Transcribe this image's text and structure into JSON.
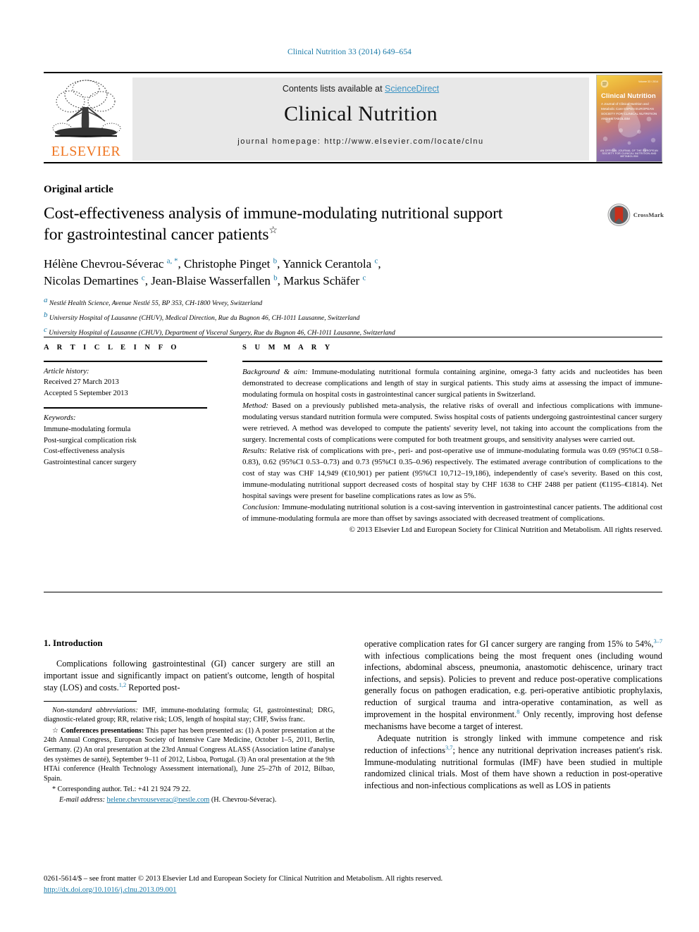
{
  "running_head": "Clinical Nutrition 33 (2014) 649–654",
  "masthead": {
    "contents_prefix": "Contents lists available at ",
    "sciencedirect": "ScienceDirect",
    "journal_name": "Clinical Nutrition",
    "homepage": "journal homepage: http://www.elsevier.com/locate/clnu",
    "publisher": "ELSEVIER",
    "cover": {
      "title": "Clinical Nutrition",
      "subtitle": "A Journal of Clinical Nutrition and Metabolic Care\nESPEN EUROPEAN SOCIETY FOR CLINICAL NUTRITION AND METABOLISM",
      "issue_line": "Volume 33 / 2014",
      "footer": "AN OFFICIAL JOURNAL OF THE EUROPEAN SOCIETY FOR CLINICAL NUTRITION AND METABOLISM"
    }
  },
  "article": {
    "type_label": "Original article",
    "title_line1": "Cost-effectiveness analysis of immune-modulating nutritional support",
    "title_line2": "for gastrointestinal cancer patients",
    "title_marker": "☆",
    "crossmark_label": "CrossMark",
    "authors_line1_html": "Hélène Chevrou-Séverac <sup>a, *</sup>, Christophe Pinget <sup>b</sup>, Yannick Cerantola <sup>c</sup>,",
    "authors_line2_html": "Nicolas Demartines <sup>c</sup>, Jean-Blaise Wasserfallen <sup>b</sup>, Markus Schäfer <sup>c</sup>",
    "affiliations": [
      {
        "mark": "a",
        "text": "Nestlé Health Science, Avenue Nestlé 55, BP 353, CH-1800 Vevey, Switzerland"
      },
      {
        "mark": "b",
        "text": "University Hospital of Lausanne (CHUV), Medical Direction, Rue du Bugnon 46, CH-1011 Lausanne, Switzerland"
      },
      {
        "mark": "c",
        "text": "University Hospital of Lausanne (CHUV), Department of Visceral Surgery, Rue du Bugnon 46, CH-1011 Lausanne, Switzerland"
      }
    ]
  },
  "article_info": {
    "heading": "A R T I C L E   I N F O",
    "history_label": "Article history:",
    "received": "Received 27 March 2013",
    "accepted": "Accepted 5 September 2013",
    "keywords_label": "Keywords:",
    "keywords": [
      "Immune-modulating formula",
      "Post-surgical complication risk",
      "Cost-effectiveness analysis",
      "Gastrointestinal cancer surgery"
    ]
  },
  "summary": {
    "heading": "S U M M A R Y",
    "sections": [
      {
        "label": "Background & aim:",
        "text": " Immune-modulating nutritional formula containing arginine, omega-3 fatty acids and nucleotides has been demonstrated to decrease complications and length of stay in surgical patients. This study aims at assessing the impact of immune-modulating formula on hospital costs in gastrointestinal cancer surgical patients in Switzerland."
      },
      {
        "label": "Method:",
        "text": " Based on a previously published meta-analysis, the relative risks of overall and infectious complications with immune-modulating versus standard nutrition formula were computed. Swiss hospital costs of patients undergoing gastrointestinal cancer surgery were retrieved. A method was developed to compute the patients' severity level, not taking into account the complications from the surgery. Incremental costs of complications were computed for both treatment groups, and sensitivity analyses were carried out."
      },
      {
        "label": "Results:",
        "text": " Relative risk of complications with pre-, peri- and post-operative use of immune-modulating formula was 0.69 (95%CI 0.58–0.83), 0.62 (95%CI 0.53–0.73) and 0.73 (95%CI 0.35–0.96) respectively. The estimated average contribution of complications to the cost of stay was CHF 14,949 (€10,901) per patient (95%CI 10,712–19,186), independently of case's severity. Based on this cost, immune-modulating nutritional support decreased costs of hospital stay by CHF 1638 to CHF 2488 per patient (€1195–€1814). Net hospital savings were present for baseline complications rates as low as 5%."
      },
      {
        "label": "Conclusion:",
        "text": " Immune-modulating nutritional solution is a cost-saving intervention in gastrointestinal cancer patients. The additional cost of immune-modulating formula are more than offset by savings associated with decreased treatment of complications."
      }
    ],
    "copyright": "© 2013 Elsevier Ltd and European Society for Clinical Nutrition and Metabolism. All rights reserved."
  },
  "introduction": {
    "heading": "1.  Introduction",
    "para1_html": "Complications following gastrointestinal (GI) cancer surgery are still an important issue and significantly impact on patient's outcome, length of hospital stay (LOS) and costs.<sup>1,2</sup> Reported post-",
    "right_para1_html": "operative complication rates for GI cancer surgery are ranging from 15% to 54%,<sup>3–7</sup> with infectious complications being the most frequent ones (including wound infections, abdominal abscess, pneumonia, anastomotic dehiscence, urinary tract infections, and sepsis). Policies to prevent and reduce post-operative complications generally focus on pathogen eradication, e.g. peri-operative antibiotic prophylaxis, reduction of surgical trauma and intra-operative contamination, as well as improvement in the hospital environment.<sup>8</sup> Only recently, improving host defense mechanisms have become a target of interest.",
    "right_para2_html": "Adequate nutrition is strongly linked with immune competence and risk reduction of infections<sup>3,7</sup>; hence any nutritional deprivation increases patient's risk. Immune-modulating nutritional formulas (IMF) have been studied in multiple randomized clinical trials. Most of them have shown a reduction in post-operative infectious and non-infectious complications as well as LOS in patients"
  },
  "footnotes": {
    "abbrev_label": "Non-standard abbreviations:",
    "abbrev_text": " IMF, immune-modulating formula; GI, gastrointestinal; DRG, diagnostic-related group; RR, relative risk; LOS, length of hospital stay; CHF, Swiss franc.",
    "conf_marker": "☆",
    "conf_label": "Conferences presentations:",
    "conf_text": " This paper has been presented as: (1) A poster presentation at the 24th Annual Congress, European Society of Intensive Care Medicine, October 1–5, 2011, Berlin, Germany. (2) An oral presentation at the 23rd Annual Congress ALASS (Association latine d'analyse des systèmes de santé), September 9–11 of 2012, Lisboa, Portugal. (3) An oral presentation at the 9th HTAi conference (Health Technology Assessment international), June 25–27th of 2012, Bilbao, Spain.",
    "corr_marker": "*",
    "corr_text": " Corresponding author. Tel.: +41 21 924 79 22.",
    "email_label": "E-mail address:",
    "email": "helene.chevrouseverac@nestle.com",
    "email_suffix": " (H. Chevrou-Séverac)."
  },
  "page_footer": {
    "issn_line": "0261-5614/$ – see front matter © 2013 Elsevier Ltd and European Society for Clinical Nutrition and Metabolism. All rights reserved.",
    "doi": "http://dx.doi.org/10.1016/j.clnu.2013.09.001"
  },
  "colors": {
    "link": "#1a7aa8",
    "sciencedirect": "#3a93c4",
    "elsevier_orange": "#ef7622",
    "band_gray": "#e8e8e8"
  }
}
